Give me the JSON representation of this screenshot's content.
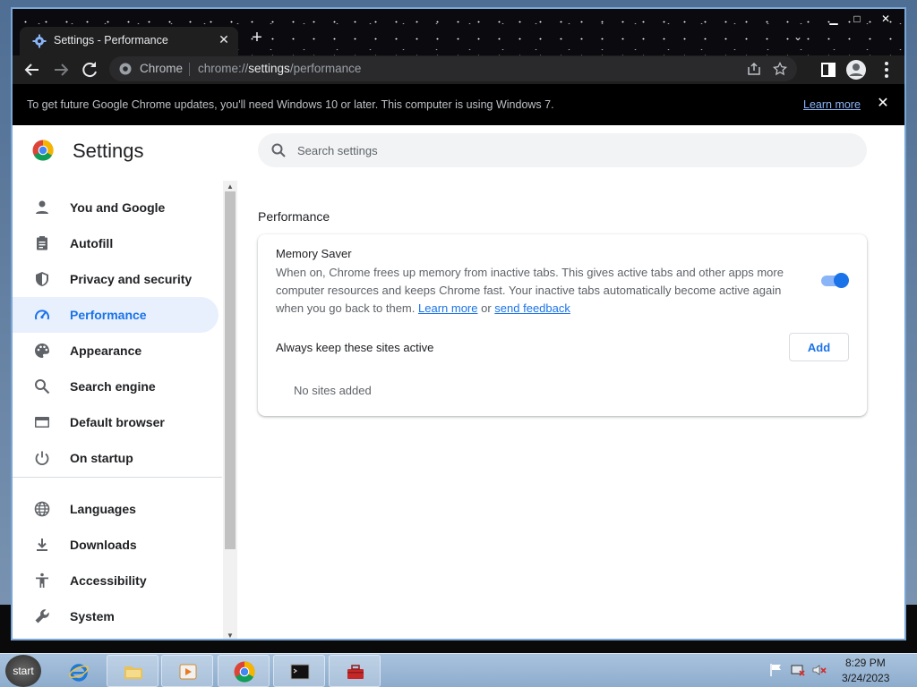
{
  "window": {
    "tab_title": "Settings - Performance",
    "tab_close_glyph": "✕",
    "new_tab_glyph": "+",
    "tab_list_glyph": "⌄",
    "minimize_glyph": "▁",
    "maximize_glyph": "□",
    "close_glyph": "✕"
  },
  "omnibox": {
    "site_label": "Chrome",
    "url_prefix": "chrome://",
    "url_host": "settings",
    "url_path": "/performance"
  },
  "infobar": {
    "message": "To get future Google Chrome updates, you'll need Windows 10 or later. This computer is using Windows 7.",
    "link": "Learn more",
    "close_glyph": "✕"
  },
  "settings": {
    "title": "Settings",
    "search_placeholder": "Search settings",
    "nav": [
      {
        "label": "You and Google",
        "icon": "person-icon"
      },
      {
        "label": "Autofill",
        "icon": "clipboard-icon"
      },
      {
        "label": "Privacy and security",
        "icon": "shield-icon"
      },
      {
        "label": "Performance",
        "icon": "speedometer-icon",
        "active": true
      },
      {
        "label": "Appearance",
        "icon": "palette-icon"
      },
      {
        "label": "Search engine",
        "icon": "search-icon"
      },
      {
        "label": "Default browser",
        "icon": "browser-icon"
      },
      {
        "label": "On startup",
        "icon": "power-icon"
      },
      {
        "label": "Languages",
        "icon": "globe-icon"
      },
      {
        "label": "Downloads",
        "icon": "download-icon"
      },
      {
        "label": "Accessibility",
        "icon": "accessibility-icon"
      },
      {
        "label": "System",
        "icon": "wrench-icon"
      }
    ]
  },
  "performance": {
    "section_title": "Performance",
    "memory_saver_title": "Memory Saver",
    "memory_saver_desc": "When on, Chrome frees up memory from inactive tabs. This gives active tabs and other apps more computer resources and keeps Chrome fast. Your inactive tabs automatically become active again when you go back to them.",
    "learn_more": "Learn more",
    "or_text": "or",
    "send_feedback": "send feedback",
    "memory_saver_on": true,
    "keep_active_label": "Always keep these sites active",
    "add_button": "Add",
    "no_sites": "No sites added"
  },
  "taskbar": {
    "start_label": "start",
    "time": "8:29 PM",
    "date": "3/24/2023"
  },
  "colors": {
    "accent": "#1a73e8",
    "active_nav_bg": "#e8f0fe",
    "toggle_track": "#8ab4f8",
    "infobar_bg": "#000000"
  }
}
